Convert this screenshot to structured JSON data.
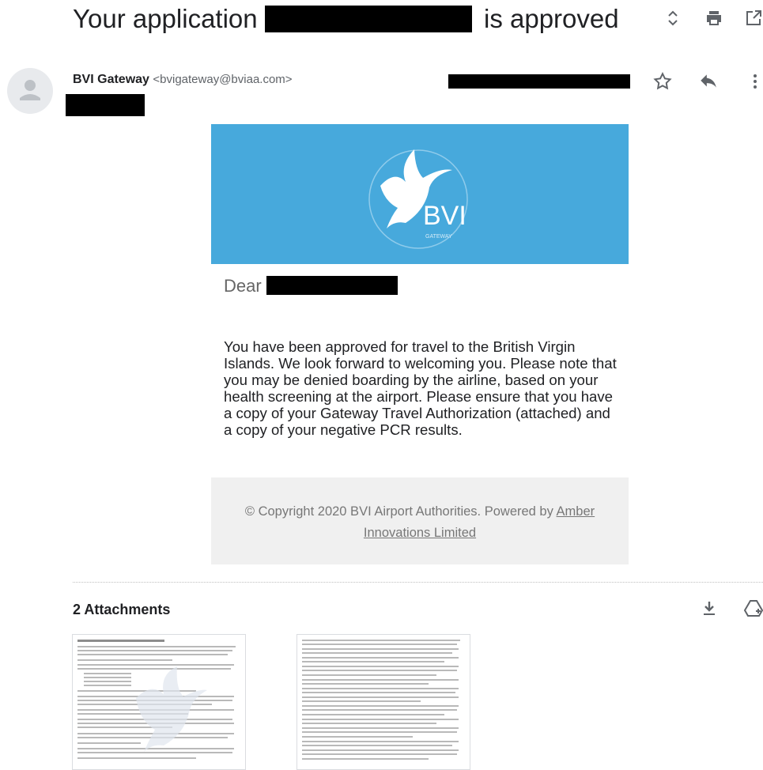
{
  "subject": {
    "prefix": "Your application",
    "suffix": "is approved"
  },
  "sender": {
    "name": "BVI Gateway",
    "email": "<bvigateway@bviaa.com>"
  },
  "header_icons": [
    "expand-collapse-icon",
    "print-icon",
    "open-in-new-window-icon"
  ],
  "row_icons": [
    "star-icon",
    "reply-icon",
    "more-options-icon"
  ],
  "hero": {
    "logo_text": "BVI",
    "logo_subtext": "GATEWAY",
    "background": "#47a9dc"
  },
  "greeting": "Dear",
  "body": "You have been approved for travel to the British Virgin Islands. We look forward to welcoming you. Please note that you may be denied boarding by the airline, based on your health screening at the airport. Please ensure that you have a copy of your Gateway Travel Authorization (attached) and a copy of your negative PCR results.",
  "footer": {
    "text": "© Copyright 2020 BVI Airport Authorities. Powered by",
    "link": "Amber Innovations Limited"
  },
  "attachments": {
    "title": "2 Attachments",
    "actions": [
      "download-all-icon",
      "save-to-drive-icon"
    ]
  }
}
